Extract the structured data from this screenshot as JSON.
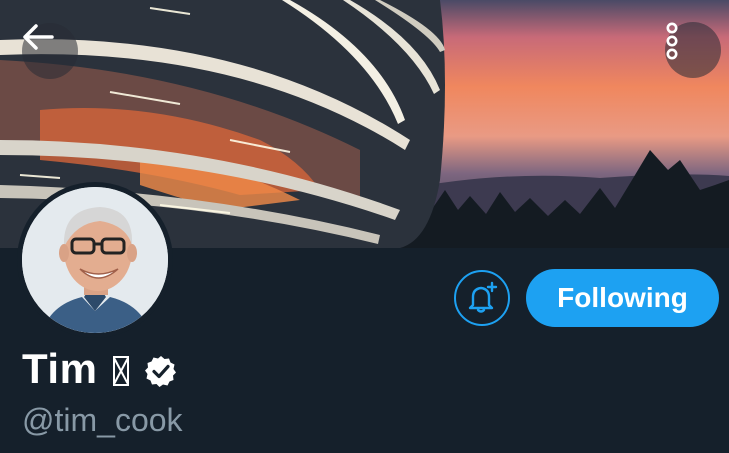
{
  "banner": {
    "description_icon": "apple-park-photo"
  },
  "navigation": {
    "back_icon": "arrow-left-icon",
    "more_icon": "more-vertical-icon"
  },
  "profile": {
    "display_name": "Tim",
    "name_emoji_fallback": "□",
    "verified_icon": "verified-badge-icon",
    "handle": "@tim_cook"
  },
  "actions": {
    "notify_icon": "bell-plus-icon",
    "following_label": "Following"
  },
  "colors": {
    "background": "#15202b",
    "accent": "#1da1f2",
    "secondary_text": "#8899a6"
  }
}
